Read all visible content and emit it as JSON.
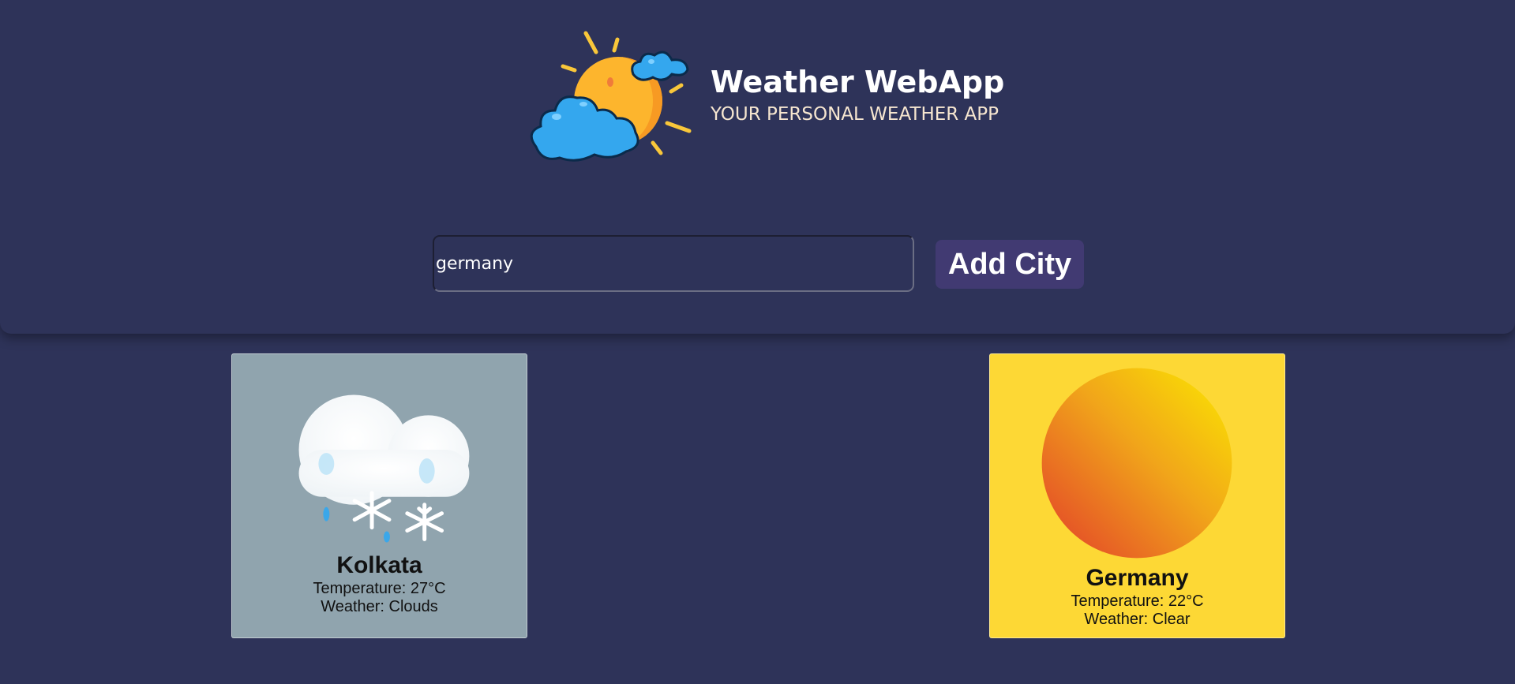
{
  "app": {
    "title": "Weather WebApp",
    "subtitle": "YOUR PERSONAL WEATHER APP",
    "logo_icon": "sun-with-clouds-icon"
  },
  "search": {
    "value": "germany",
    "add_label": "Add City"
  },
  "colors": {
    "background": "#2e3359",
    "button": "#413a72",
    "clouds_card": "#90a4ae",
    "clear_card": "#fdd835"
  },
  "cards": [
    {
      "city": "Kolkata",
      "temperature": "Temperature: 27°C",
      "weather": "Weather: Clouds",
      "icon": "cloud-snow-icon"
    },
    {
      "city": "Germany",
      "temperature": "Temperature: 22°C",
      "weather": "Weather: Clear",
      "icon": "sun-icon"
    }
  ]
}
